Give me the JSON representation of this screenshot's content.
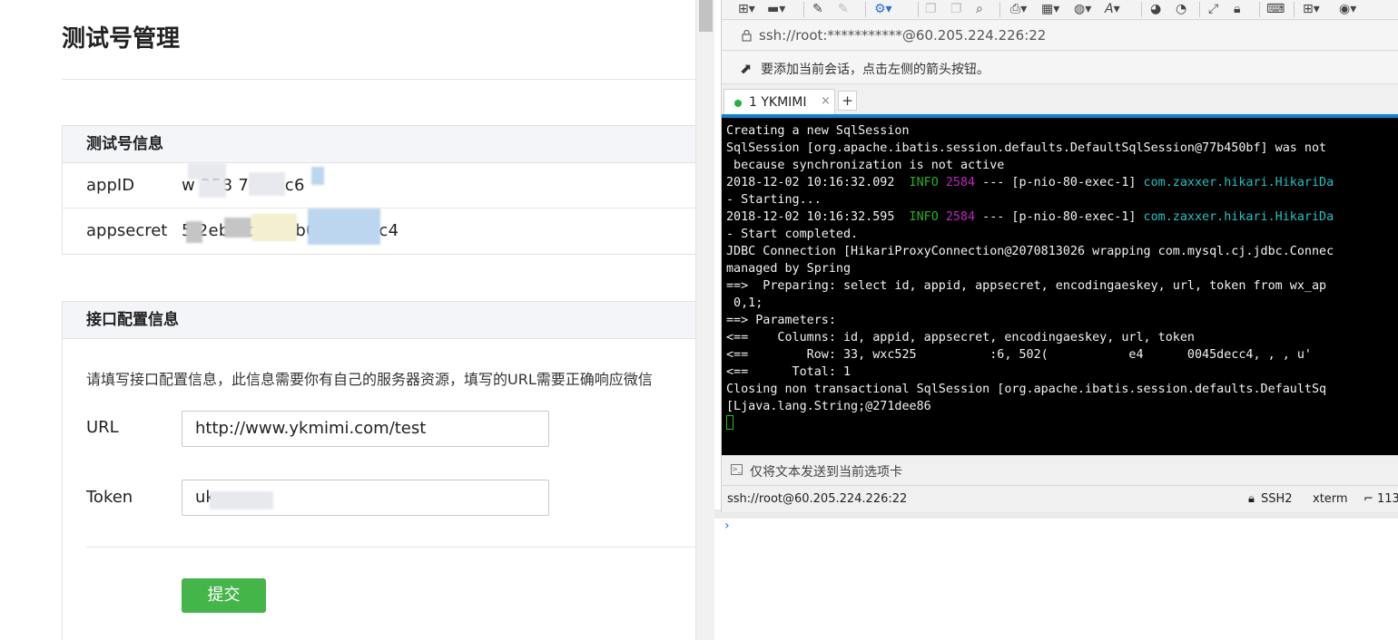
{
  "web": {
    "page_title": "测试号管理",
    "test_info": {
      "heading": "测试号信息",
      "appid_label": "appID",
      "appid_value": "w    258      7c4 9c6",
      "appsecret_label": "appsecret",
      "appsecret_value": "5  2eb      1c1cc          fb0045decc4"
    },
    "iface": {
      "heading": "接口配置信息",
      "description": "请填写接口配置信息，此信息需要你有自己的服务器资源，填写的URL需要正确响应微信",
      "url_label": "URL",
      "url_value": "http://www.ykmimi.com/test",
      "token_label": "Token",
      "token_value": "uk",
      "submit_label": "提交"
    }
  },
  "devtools": {
    "prompt": "›"
  },
  "xshell": {
    "address": "ssh://root:***********@60.205.224.226:22",
    "hint": "要添加当前会话，点击左侧的箭头按钮。",
    "tab": {
      "label": "1 YKMIMI",
      "close": "×",
      "add": "+"
    },
    "terminal": {
      "l1": "Creating a new SqlSession",
      "l2": "SqlSession [org.apache.ibatis.session.defaults.DefaultSqlSession@77b450bf] was not",
      "l3": " because synchronization is not active",
      "l4a": "2018-12-02 10:16:32.092  ",
      "l4b": "INFO",
      "l4c": "2584",
      "l4d": " --- [p-nio-80-exec-1] ",
      "l4e": "com.zaxxer.hikari.HikariDa",
      "l5": "- Starting...",
      "l6a": "2018-12-02 10:16:32.595  ",
      "l6b": "INFO",
      "l6c": "2584",
      "l6d": " --- [p-nio-80-exec-1] ",
      "l6e": "com.zaxxer.hikari.HikariDa",
      "l7": "- Start completed.",
      "l8": "JDBC Connection [HikariProxyConnection@2070813026 wrapping com.mysql.cj.jdbc.Connec",
      "l9": "managed by Spring",
      "l10": "==>  Preparing: select id, appid, appsecret, encodingaeskey, url, token from wx_ap",
      "l11": " 0,1;",
      "l12": "==> Parameters: ",
      "l13": "<==    Columns: id, appid, appsecret, encodingaeskey, url, token",
      "l14": "<==        Row: 33, wxc525          :6, 502(           e4      0045decc4, , , u'",
      "l15": "<==      Total: 1",
      "l16": "Closing non transactional SqlSession [org.apache.ibatis.session.defaults.DefaultSq",
      "l17": "[Ljava.lang.String;@271dee86"
    },
    "send_text": "仅将文本发送到当前选项卡",
    "status": {
      "conn": "ssh://root@60.205.224.226:22",
      "proto": "SSH2",
      "term": "xterm",
      "size": "113"
    }
  }
}
